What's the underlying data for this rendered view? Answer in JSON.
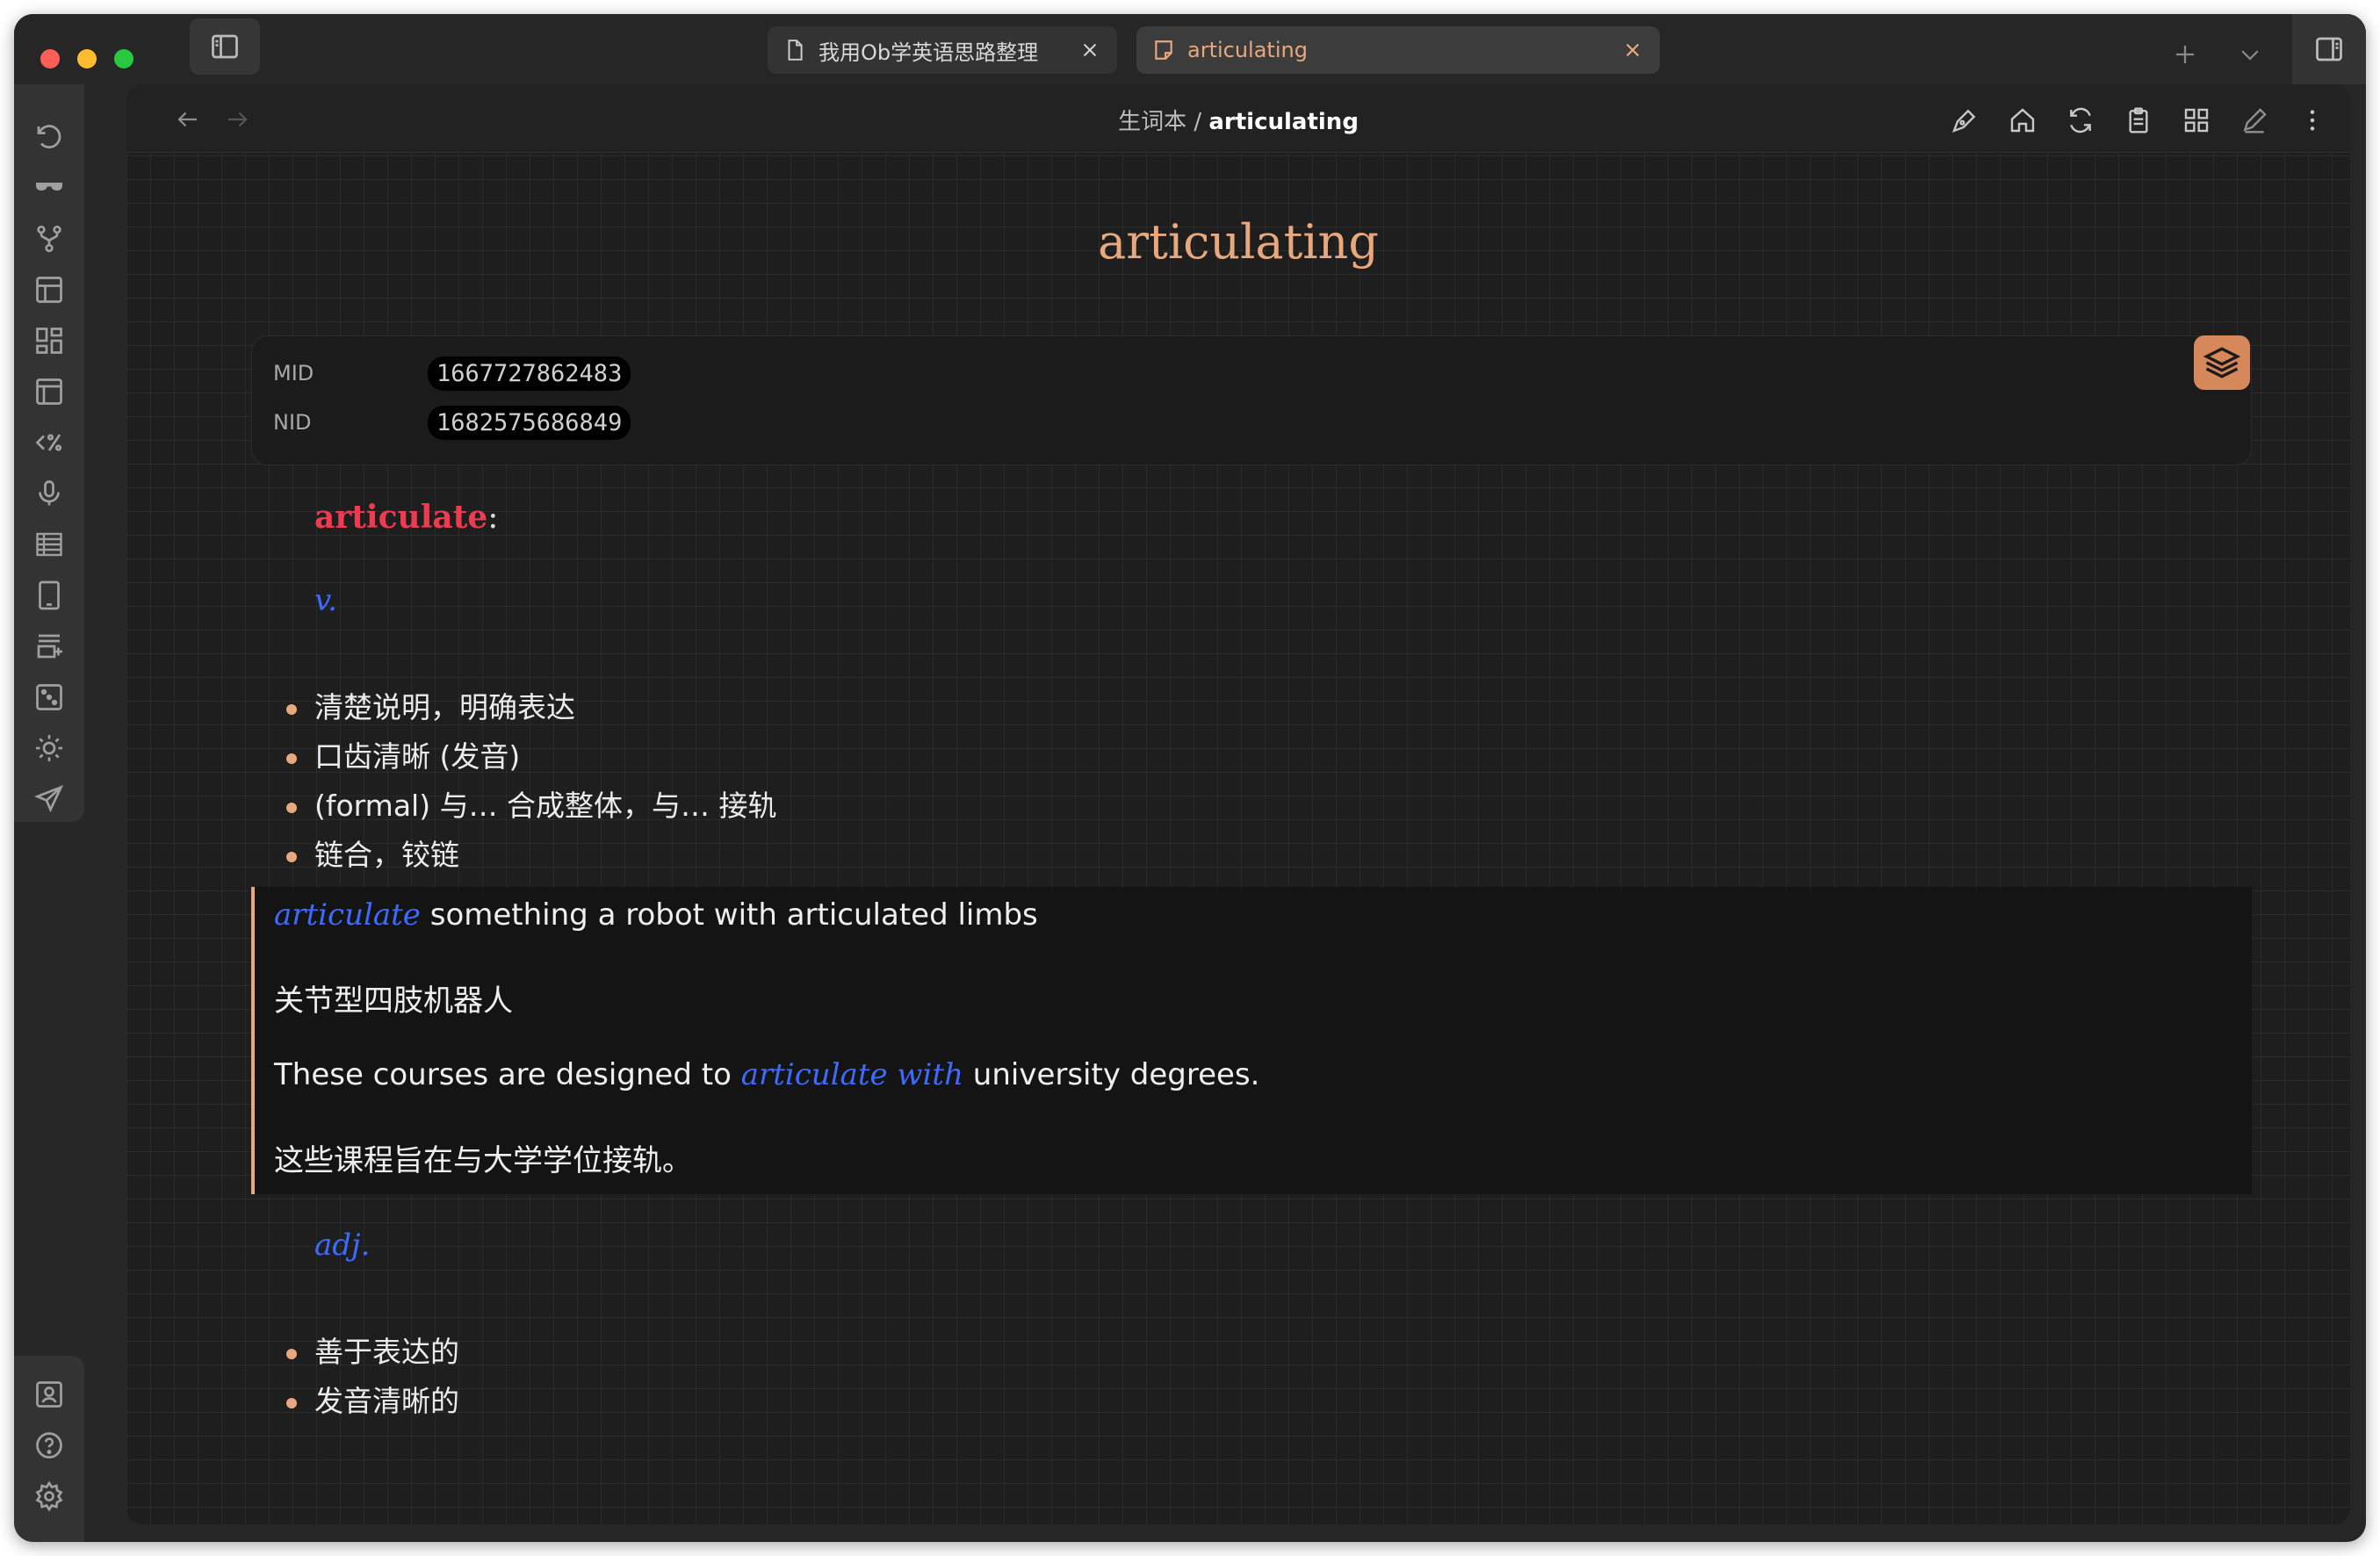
{
  "tabs": [
    {
      "title": "我用Ob学英语思路整理",
      "active": false
    },
    {
      "title": "articulating",
      "active": true
    }
  ],
  "breadcrumb": {
    "folder": "生词本",
    "separator": " / ",
    "current": "articulating"
  },
  "note": {
    "title": "articulating",
    "properties": [
      {
        "key": "MID",
        "value": "1667727862483"
      },
      {
        "key": "NID",
        "value": "1682575686849"
      }
    ],
    "headword": "articulate",
    "headword_colon": ":",
    "verb": {
      "pos": "v.",
      "definitions": [
        "清楚说明，明确表达",
        "口齿清晰 (发音)",
        "(formal) 与… 合成整体，与… 接轨",
        "链合，铰链"
      ]
    },
    "examples": {
      "line1_highlight": "articulate",
      "line1_rest": " something a robot with articulated limbs",
      "line2": "关节型四肢机器人",
      "line3_before": "These courses are designed to ",
      "line3_highlight": "articulate with",
      "line3_after": " university degrees.",
      "line4": "这些课程旨在与大学学位接轨。"
    },
    "adjective": {
      "pos": "adj.",
      "definitions": [
        "善于表达的",
        "发音清晰的"
      ]
    }
  },
  "colors": {
    "accent": "#e8a77c",
    "headword": "#ef3b4f",
    "highlight": "#3e6bff",
    "background": "#1e1e1e"
  },
  "icons": {
    "ribbon_top": [
      "undo-icon",
      "sunglasses-icon",
      "git-fork-icon",
      "layout-icon",
      "dashboard-icon",
      "template-icon",
      "code-percent-icon",
      "microphone-icon",
      "table-icon",
      "tablet-icon",
      "add-card-icon",
      "dice-icon",
      "sun-icon",
      "send-icon"
    ],
    "ribbon_bottom": [
      "vault-icon",
      "help-icon",
      "settings-icon"
    ],
    "view_header": [
      "pen-icon",
      "home-icon",
      "refresh-icon",
      "clipboard-icon",
      "grid-icon",
      "edit-icon",
      "more-icon"
    ]
  }
}
